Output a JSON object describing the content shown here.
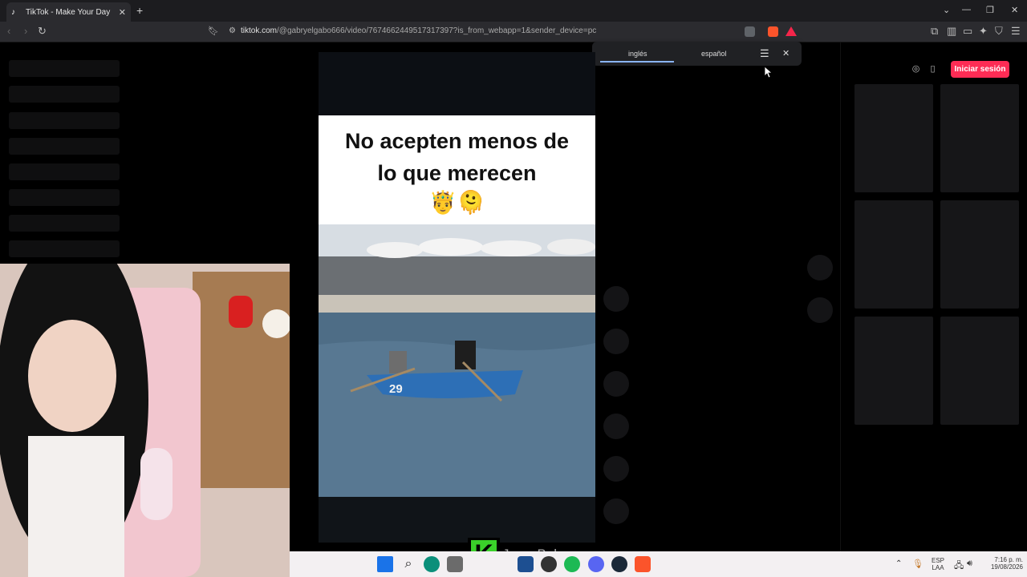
{
  "browser": {
    "tab_title": "TikTok - Make Your Day",
    "new_tab_label": "+",
    "url_host": "tiktok.com",
    "url_path": "/@gabryelgabo666/video/7674662449517317397?is_from_webapp=1&sender_device=pc"
  },
  "translate_bar": {
    "source_language": "inglés",
    "target_language": "español"
  },
  "tiktok": {
    "login_button": "Iniciar sesión"
  },
  "video": {
    "caption_line1": "No acepten menos de",
    "caption_line2": "lo que merecen",
    "caption_emoji": "🤴🫠",
    "boat_number": "29"
  },
  "overlay": {
    "logo_letter": "K",
    "stream_name": "JessyBaby"
  },
  "taskbar": {
    "lang_line1": "ESP",
    "lang_line2": "LAA",
    "time": "7:16 p. m.",
    "date": "19/08/2026"
  },
  "colors": {
    "accent": "#fe2c55",
    "translate_underline": "#8ab4f8",
    "page_bg": "#000000"
  }
}
